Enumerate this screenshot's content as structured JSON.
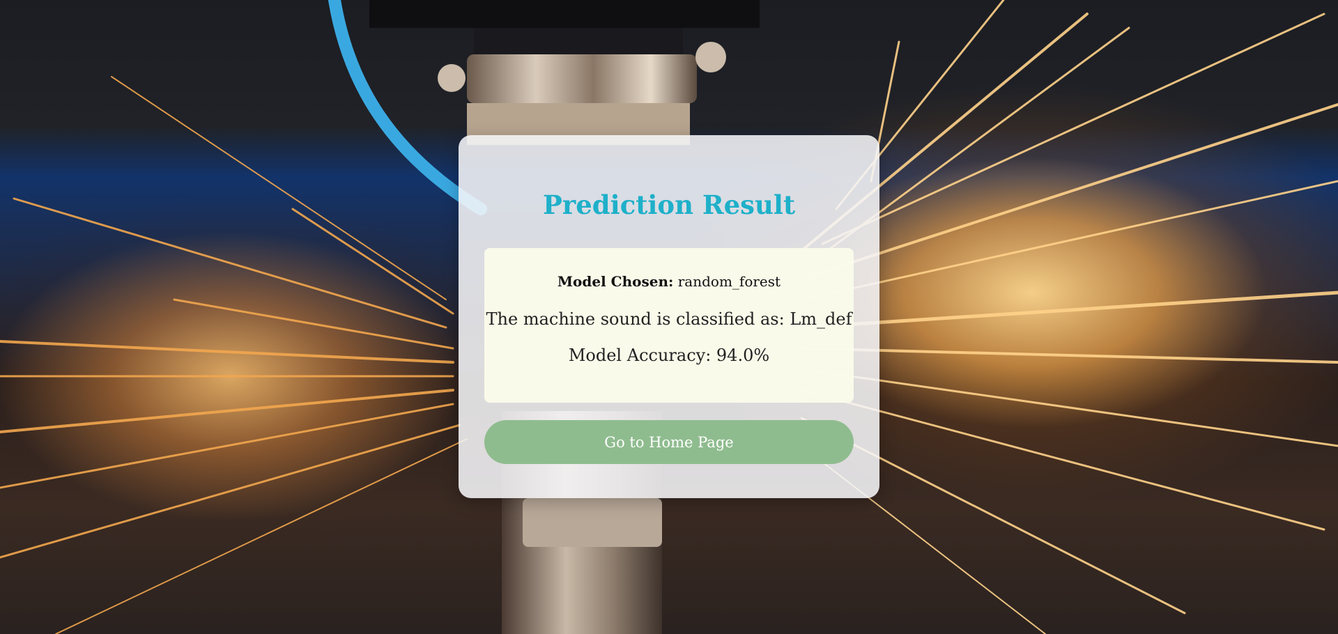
{
  "page": {
    "title": "Prediction Result"
  },
  "result": {
    "model_label": "Model Chosen:",
    "model_value": "random_forest",
    "classification_text": "The machine sound is classified as: Lm_def",
    "accuracy_text": "Model Accuracy: 94.0%"
  },
  "actions": {
    "home_button_label": "Go to Home Page"
  },
  "colors": {
    "title": "#1eb0c9",
    "button": "#8fbc8f",
    "result_box": "#fafbe9"
  },
  "background": {
    "description_icon": "laser-cutter-sparks-image"
  }
}
